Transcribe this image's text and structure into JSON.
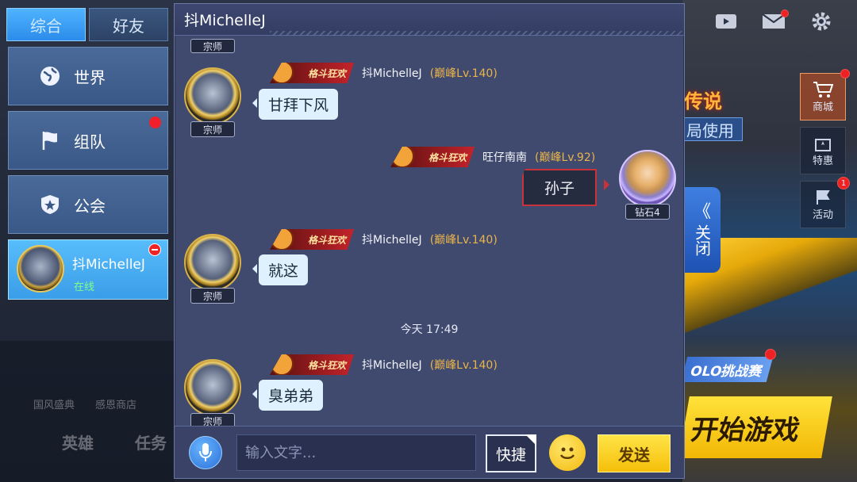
{
  "top_bar": {
    "icons": [
      "video-icon",
      "mail-icon",
      "gear-icon"
    ]
  },
  "right_menu": {
    "shop": "商城",
    "special": "特惠",
    "activity": "活动",
    "activity_badge": "1"
  },
  "background": {
    "promo_word": "传说",
    "promo_use": "局使用",
    "solo_challenge": "OLO挑战赛",
    "start_game": "开始游戏",
    "close_tab_chevron": "《",
    "close_tab_label": "关闭",
    "dim_items": [
      "国风盛典",
      "感恩商店"
    ],
    "dim_big": [
      "英雄",
      "任务"
    ]
  },
  "sidebar": {
    "tabs": [
      {
        "label": "综合",
        "active": true
      },
      {
        "label": "好友",
        "active": false
      }
    ],
    "items": [
      {
        "label": "世界",
        "icon": "globe-icon",
        "has_dot": false
      },
      {
        "label": "组队",
        "icon": "flag-icon",
        "has_dot": true
      },
      {
        "label": "公会",
        "icon": "shield-star-icon",
        "has_dot": false
      }
    ],
    "friend": {
      "name": "抖MichelleJ",
      "status": "在线"
    }
  },
  "chat": {
    "title": "抖MichelleJ",
    "top_rank_partial": "宗师",
    "fight_badge_text": "格斗狂欢",
    "messages": [
      {
        "name": "抖MichelleJ",
        "level": "(巅峰Lv.140)",
        "rank": "宗师",
        "text": "甘拜下风",
        "self": false
      },
      {
        "name": "旺仔南南",
        "level": "(巅峰Lv.92)",
        "rank": "钻石4",
        "text": "孙子",
        "self": true
      },
      {
        "name": "抖MichelleJ",
        "level": "(巅峰Lv.140)",
        "rank": "宗师",
        "text": "就这",
        "self": false
      },
      {
        "name": "抖MichelleJ",
        "level": "(巅峰Lv.140)",
        "rank": "宗师",
        "text": "臭弟弟",
        "self": false
      }
    ],
    "timestamp": "今天 17:49"
  },
  "input_bar": {
    "placeholder": "输入文字...",
    "quick_label": "快捷",
    "send_label": "发送"
  },
  "colors": {
    "panel_bg": "#404a6e",
    "tab_active": "#2c8cea",
    "send_button": "#f5bf0a",
    "level_text": "#e9b44c",
    "friend_card": "#3a9de8"
  }
}
